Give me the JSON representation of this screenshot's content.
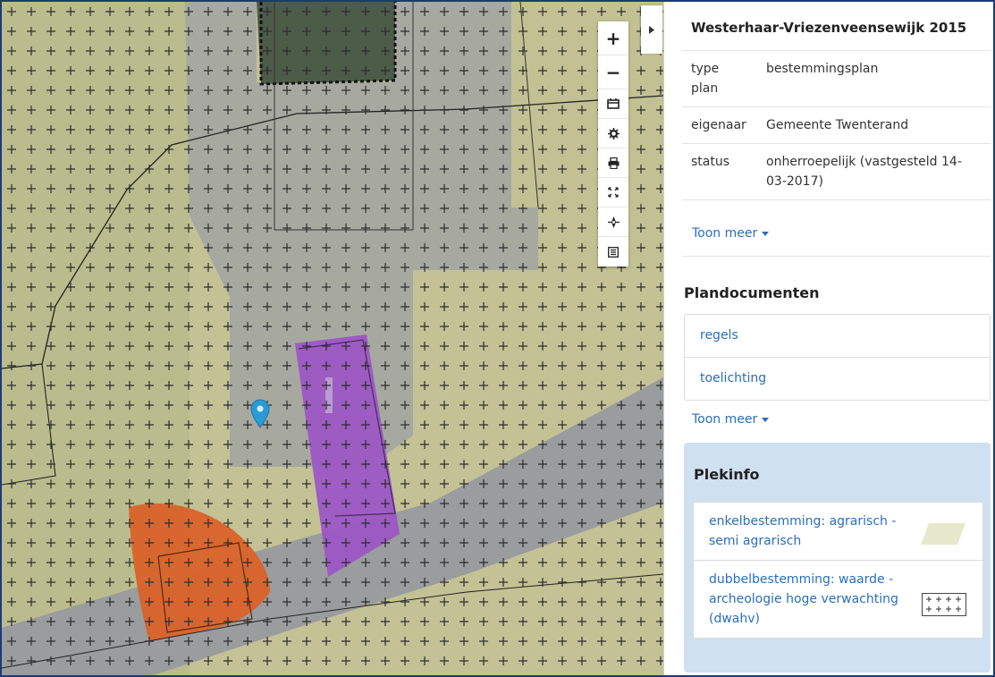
{
  "map": {
    "controls": [
      {
        "name": "zoom-in-button",
        "icon": "plus-icon",
        "label": "+"
      },
      {
        "name": "zoom-out-button",
        "icon": "minus-icon",
        "label": "−"
      },
      {
        "name": "layers-button",
        "icon": "map-layers-icon"
      },
      {
        "name": "settings-button",
        "icon": "gear-icon"
      },
      {
        "name": "print-button",
        "icon": "print-icon"
      },
      {
        "name": "fullscreen-button",
        "icon": "fullscreen-icon"
      },
      {
        "name": "locate-button",
        "icon": "crosshair-icon"
      },
      {
        "name": "legend-button",
        "icon": "list-icon"
      }
    ],
    "colors": {
      "agrarisch": "#c8c99a",
      "grey_zone": "#a7a9a6",
      "purple": "#9b57c4",
      "orange": "#d9622a",
      "marker": "#2a9bd6"
    }
  },
  "panel": {
    "plan_title": "Westerhaar-Vriezenveensewijk 2015",
    "info": [
      {
        "key": "type plan",
        "value": "bestemmingsplan"
      },
      {
        "key": "eigenaar",
        "value": "Gemeente Twenterand"
      },
      {
        "key": "status",
        "value": "onherroepelijk (vastgesteld 14-03-2017)"
      }
    ],
    "toon_meer_1": "Toon meer",
    "plandocumenten_title": "Plandocumenten",
    "documents": [
      "regels",
      "toelichting"
    ],
    "toon_meer_2": "Toon meer",
    "plekinfo": {
      "title": "Plekinfo",
      "items": [
        {
          "label": "enkelbestemming: agrarisch - semi agrarisch",
          "swatch": "#e6e9cc"
        },
        {
          "label": "dubbelbestemming: waarde - archeologie hoge verwachting (dwahv)",
          "swatch": "crosses"
        }
      ]
    }
  }
}
